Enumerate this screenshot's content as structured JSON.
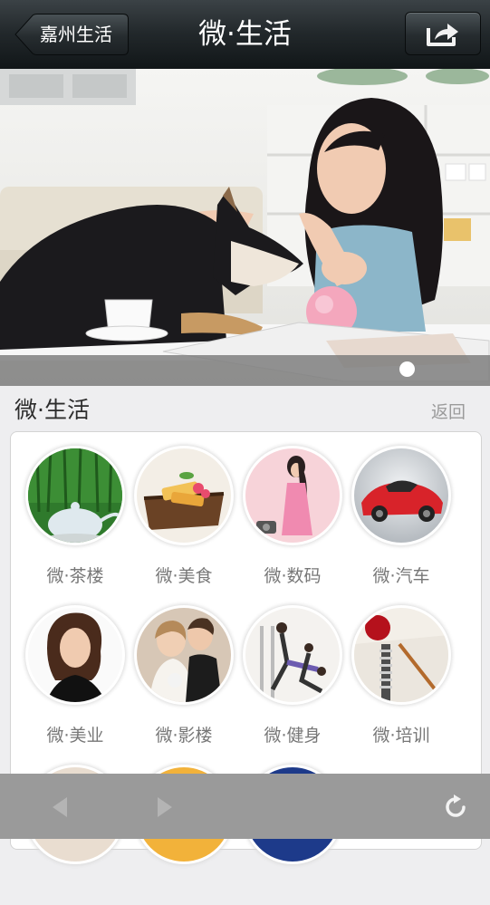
{
  "navbar": {
    "back_label": "嘉州生活",
    "title": "微·生活",
    "share_icon": "share-icon"
  },
  "banner": {
    "image": "woman-feeding-dog-photo",
    "active_slide": 1
  },
  "section": {
    "title": "微·生活",
    "return_label": "返回"
  },
  "grid": {
    "items": [
      {
        "label": "微·茶楼",
        "icon": "teahouse-thumb"
      },
      {
        "label": "微·美食",
        "icon": "food-thumb"
      },
      {
        "label": "微·数码",
        "icon": "digital-thumb"
      },
      {
        "label": "微·汽车",
        "icon": "car-thumb"
      },
      {
        "label": "微·美业",
        "icon": "beauty-thumb"
      },
      {
        "label": "微·影楼",
        "icon": "photo-studio-thumb"
      },
      {
        "label": "微·健身",
        "icon": "fitness-thumb"
      },
      {
        "label": "微·培训",
        "icon": "training-thumb"
      }
    ]
  },
  "toolbar": {
    "back_icon": "arrow-left-icon",
    "forward_icon": "arrow-right-icon",
    "refresh_icon": "refresh-icon"
  }
}
